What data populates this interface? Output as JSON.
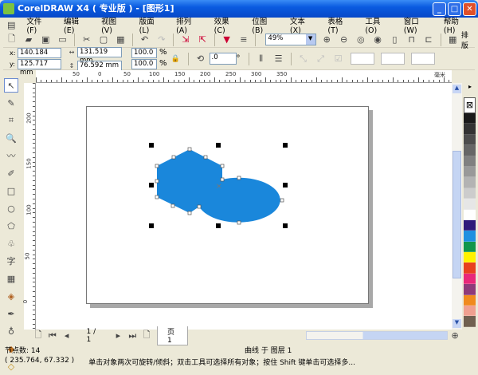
{
  "window": {
    "title": "CorelDRAW X4 ( 专业版 ) - [图形1]",
    "minimize": "_",
    "maximize": "□",
    "close": "✕"
  },
  "menu": [
    "文件(F)",
    "编辑(E)",
    "视图(V)",
    "版面(L)",
    "排列(A)",
    "效果(C)",
    "位图(B)",
    "文本(X)",
    "表格(T)",
    "工具(O)",
    "窗口(W)",
    "帮助(H)"
  ],
  "toolbar": {
    "zoom": "49%",
    "layout_label": "排版"
  },
  "properties": {
    "x": "140.184 mm",
    "y": "125.717 mm",
    "width": "131.519 mm",
    "height": "76.592 mm",
    "scale_x": "100.0",
    "scale_y": "100.0",
    "pct": "%",
    "rotation": ".0",
    "deg": "°"
  },
  "ruler_h": {
    "labels": [
      "50",
      "0",
      "50",
      "100",
      "150",
      "200",
      "250",
      "300",
      "350"
    ],
    "unit": "毫米"
  },
  "ruler_v": {
    "labels": [
      "200",
      "150",
      "100",
      "50",
      "0"
    ]
  },
  "palette": [
    "#1a1a1a",
    "#333333",
    "#4d4d4d",
    "#666666",
    "#808080",
    "#999999",
    "#b3b3b3",
    "#cccccc",
    "#e6e6e6",
    "#ffffff",
    "#2e1a7a",
    "#1e90e0",
    "#12964a",
    "#fff200",
    "#e84020",
    "#e8287a",
    "#8e3a7a",
    "#f08a1e",
    "#f0a090",
    "#706050"
  ],
  "shape_fill": "#1a87db",
  "pagenav": {
    "count": "1 / 1",
    "tab": "页 1"
  },
  "status": {
    "nodes": "节点数: 14",
    "object": "曲线 于 图层 1",
    "coords": "( 235.764, 67.332 )",
    "hint": "单击对象两次可旋转/倾斜；双击工具可选择所有对象；按住 Shift 键单击可选择多..."
  }
}
